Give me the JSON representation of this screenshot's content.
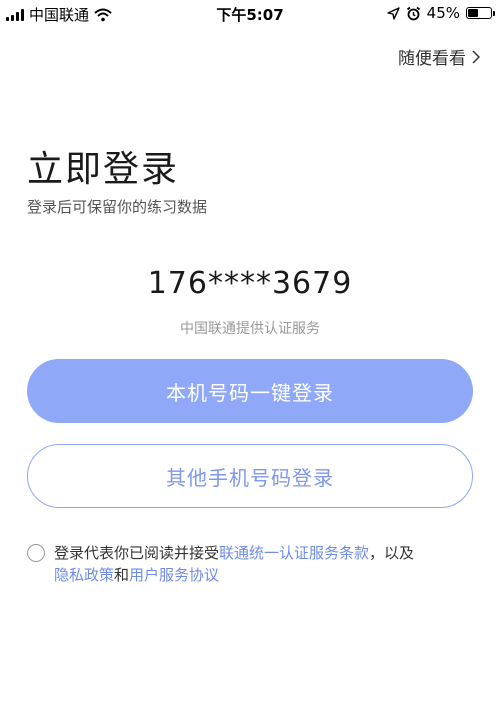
{
  "status_bar": {
    "carrier": "中国联通",
    "time": "下午5:07",
    "battery_percent": "45%",
    "battery_level": 0.45,
    "icons": [
      "signal-icon",
      "wifi-icon",
      "location-arrow-icon",
      "alarm-icon",
      "battery-icon"
    ]
  },
  "header": {
    "skip_label": "随便看看",
    "skip_icon": "chevron-right-icon"
  },
  "main": {
    "title": "立即登录",
    "subtitle": "登录后可保留你的练习数据",
    "phone_number": "176****3679",
    "provider_note": "中国联通提供认证服务"
  },
  "buttons": {
    "one_click_login": "本机号码一键登录",
    "other_phone_login": "其他手机号码登录"
  },
  "agreement": {
    "prefix": "登录代表你已阅读并接受",
    "link_terms": "联通统一认证服务条款",
    "separator": "，以及",
    "link_privacy": "隐私政策",
    "conjunction": "和",
    "link_user_agreement": "用户服务协议",
    "checked": false
  },
  "colors": {
    "primary": "#8fa8f7",
    "link": "#6f8be8",
    "text": "#1a1a1a",
    "muted": "#999999"
  }
}
